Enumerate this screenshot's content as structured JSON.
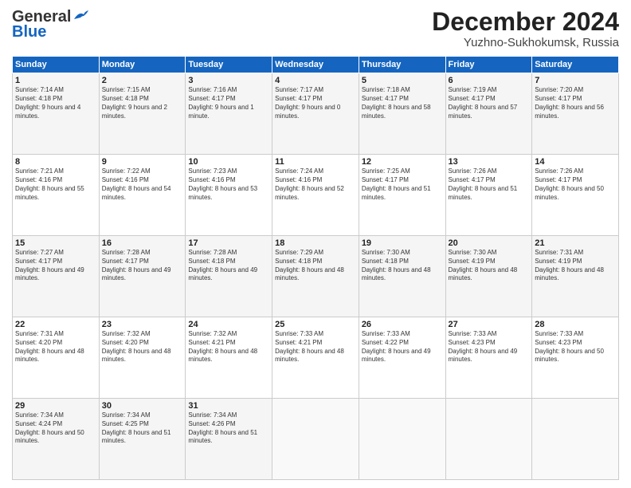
{
  "header": {
    "logo_line1": "General",
    "logo_line2": "Blue",
    "month": "December 2024",
    "location": "Yuzhno-Sukhokumsk, Russia"
  },
  "days_of_week": [
    "Sunday",
    "Monday",
    "Tuesday",
    "Wednesday",
    "Thursday",
    "Friday",
    "Saturday"
  ],
  "weeks": [
    [
      {
        "day": "1",
        "sunrise": "Sunrise: 7:14 AM",
        "sunset": "Sunset: 4:18 PM",
        "daylight": "Daylight: 9 hours and 4 minutes."
      },
      {
        "day": "2",
        "sunrise": "Sunrise: 7:15 AM",
        "sunset": "Sunset: 4:18 PM",
        "daylight": "Daylight: 9 hours and 2 minutes."
      },
      {
        "day": "3",
        "sunrise": "Sunrise: 7:16 AM",
        "sunset": "Sunset: 4:17 PM",
        "daylight": "Daylight: 9 hours and 1 minute."
      },
      {
        "day": "4",
        "sunrise": "Sunrise: 7:17 AM",
        "sunset": "Sunset: 4:17 PM",
        "daylight": "Daylight: 9 hours and 0 minutes."
      },
      {
        "day": "5",
        "sunrise": "Sunrise: 7:18 AM",
        "sunset": "Sunset: 4:17 PM",
        "daylight": "Daylight: 8 hours and 58 minutes."
      },
      {
        "day": "6",
        "sunrise": "Sunrise: 7:19 AM",
        "sunset": "Sunset: 4:17 PM",
        "daylight": "Daylight: 8 hours and 57 minutes."
      },
      {
        "day": "7",
        "sunrise": "Sunrise: 7:20 AM",
        "sunset": "Sunset: 4:17 PM",
        "daylight": "Daylight: 8 hours and 56 minutes."
      }
    ],
    [
      {
        "day": "8",
        "sunrise": "Sunrise: 7:21 AM",
        "sunset": "Sunset: 4:16 PM",
        "daylight": "Daylight: 8 hours and 55 minutes."
      },
      {
        "day": "9",
        "sunrise": "Sunrise: 7:22 AM",
        "sunset": "Sunset: 4:16 PM",
        "daylight": "Daylight: 8 hours and 54 minutes."
      },
      {
        "day": "10",
        "sunrise": "Sunrise: 7:23 AM",
        "sunset": "Sunset: 4:16 PM",
        "daylight": "Daylight: 8 hours and 53 minutes."
      },
      {
        "day": "11",
        "sunrise": "Sunrise: 7:24 AM",
        "sunset": "Sunset: 4:16 PM",
        "daylight": "Daylight: 8 hours and 52 minutes."
      },
      {
        "day": "12",
        "sunrise": "Sunrise: 7:25 AM",
        "sunset": "Sunset: 4:17 PM",
        "daylight": "Daylight: 8 hours and 51 minutes."
      },
      {
        "day": "13",
        "sunrise": "Sunrise: 7:26 AM",
        "sunset": "Sunset: 4:17 PM",
        "daylight": "Daylight: 8 hours and 51 minutes."
      },
      {
        "day": "14",
        "sunrise": "Sunrise: 7:26 AM",
        "sunset": "Sunset: 4:17 PM",
        "daylight": "Daylight: 8 hours and 50 minutes."
      }
    ],
    [
      {
        "day": "15",
        "sunrise": "Sunrise: 7:27 AM",
        "sunset": "Sunset: 4:17 PM",
        "daylight": "Daylight: 8 hours and 49 minutes."
      },
      {
        "day": "16",
        "sunrise": "Sunrise: 7:28 AM",
        "sunset": "Sunset: 4:17 PM",
        "daylight": "Daylight: 8 hours and 49 minutes."
      },
      {
        "day": "17",
        "sunrise": "Sunrise: 7:28 AM",
        "sunset": "Sunset: 4:18 PM",
        "daylight": "Daylight: 8 hours and 49 minutes."
      },
      {
        "day": "18",
        "sunrise": "Sunrise: 7:29 AM",
        "sunset": "Sunset: 4:18 PM",
        "daylight": "Daylight: 8 hours and 48 minutes."
      },
      {
        "day": "19",
        "sunrise": "Sunrise: 7:30 AM",
        "sunset": "Sunset: 4:18 PM",
        "daylight": "Daylight: 8 hours and 48 minutes."
      },
      {
        "day": "20",
        "sunrise": "Sunrise: 7:30 AM",
        "sunset": "Sunset: 4:19 PM",
        "daylight": "Daylight: 8 hours and 48 minutes."
      },
      {
        "day": "21",
        "sunrise": "Sunrise: 7:31 AM",
        "sunset": "Sunset: 4:19 PM",
        "daylight": "Daylight: 8 hours and 48 minutes."
      }
    ],
    [
      {
        "day": "22",
        "sunrise": "Sunrise: 7:31 AM",
        "sunset": "Sunset: 4:20 PM",
        "daylight": "Daylight: 8 hours and 48 minutes."
      },
      {
        "day": "23",
        "sunrise": "Sunrise: 7:32 AM",
        "sunset": "Sunset: 4:20 PM",
        "daylight": "Daylight: 8 hours and 48 minutes."
      },
      {
        "day": "24",
        "sunrise": "Sunrise: 7:32 AM",
        "sunset": "Sunset: 4:21 PM",
        "daylight": "Daylight: 8 hours and 48 minutes."
      },
      {
        "day": "25",
        "sunrise": "Sunrise: 7:33 AM",
        "sunset": "Sunset: 4:21 PM",
        "daylight": "Daylight: 8 hours and 48 minutes."
      },
      {
        "day": "26",
        "sunrise": "Sunrise: 7:33 AM",
        "sunset": "Sunset: 4:22 PM",
        "daylight": "Daylight: 8 hours and 49 minutes."
      },
      {
        "day": "27",
        "sunrise": "Sunrise: 7:33 AM",
        "sunset": "Sunset: 4:23 PM",
        "daylight": "Daylight: 8 hours and 49 minutes."
      },
      {
        "day": "28",
        "sunrise": "Sunrise: 7:33 AM",
        "sunset": "Sunset: 4:23 PM",
        "daylight": "Daylight: 8 hours and 50 minutes."
      }
    ],
    [
      {
        "day": "29",
        "sunrise": "Sunrise: 7:34 AM",
        "sunset": "Sunset: 4:24 PM",
        "daylight": "Daylight: 8 hours and 50 minutes."
      },
      {
        "day": "30",
        "sunrise": "Sunrise: 7:34 AM",
        "sunset": "Sunset: 4:25 PM",
        "daylight": "Daylight: 8 hours and 51 minutes."
      },
      {
        "day": "31",
        "sunrise": "Sunrise: 7:34 AM",
        "sunset": "Sunset: 4:26 PM",
        "daylight": "Daylight: 8 hours and 51 minutes."
      },
      null,
      null,
      null,
      null
    ]
  ]
}
